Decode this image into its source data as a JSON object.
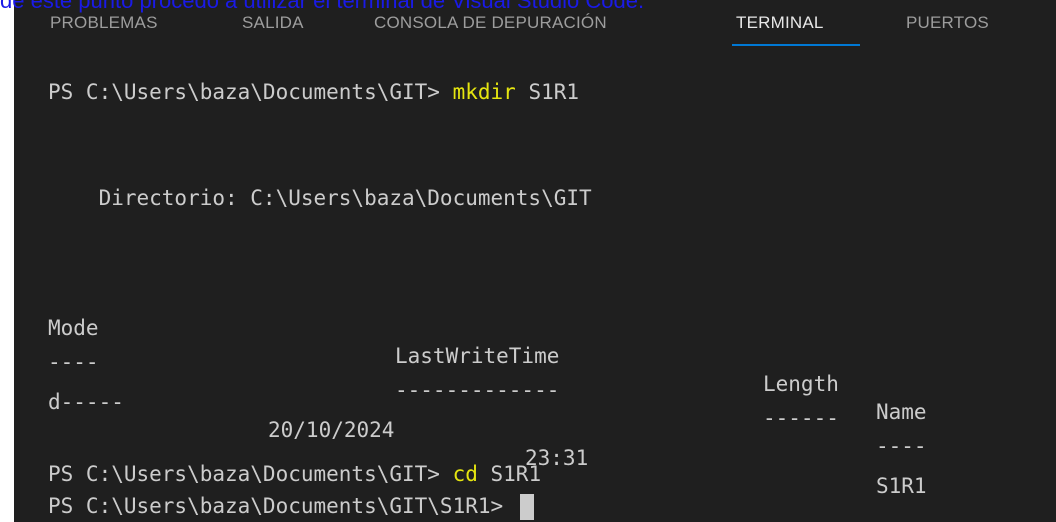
{
  "caption": "de este punto procedo a utilizar el terminal de Visual Studio Code.",
  "tabs": [
    {
      "label": "PROBLEMAS"
    },
    {
      "label": "SALIDA"
    },
    {
      "label": "CONSOLA DE DEPURACIÓN"
    },
    {
      "label": "TERMINAL",
      "active": true
    },
    {
      "label": "PUERTOS"
    }
  ],
  "terminal": {
    "prompt1": "PS C:\\Users\\baza\\Documents\\GIT> ",
    "command1": "mkdir",
    "args1": " S1R1",
    "directory_line": "    Directorio: C:\\Users\\baza\\Documents\\GIT",
    "headers": {
      "mode": "Mode",
      "lastwritetime": "LastWriteTime",
      "length": "Length",
      "name": "Name"
    },
    "separators": {
      "mode": "----",
      "lastwritetime": "-------------",
      "length": "------",
      "name": "----"
    },
    "row": {
      "mode": "d-----",
      "date": "20/10/2024",
      "time": "23:31",
      "name": "S1R1"
    },
    "prompt2": "PS C:\\Users\\baza\\Documents\\GIT> ",
    "command2": "cd",
    "args2": " S1R1",
    "prompt3": "PS C:\\Users\\baza\\Documents\\GIT\\S1R1> "
  },
  "colors": {
    "background": "#1f1f1f",
    "text": "#cccccc",
    "command": "#e5e510",
    "active_tab_underline": "#0078d4",
    "caption": "#1a1ae6"
  }
}
